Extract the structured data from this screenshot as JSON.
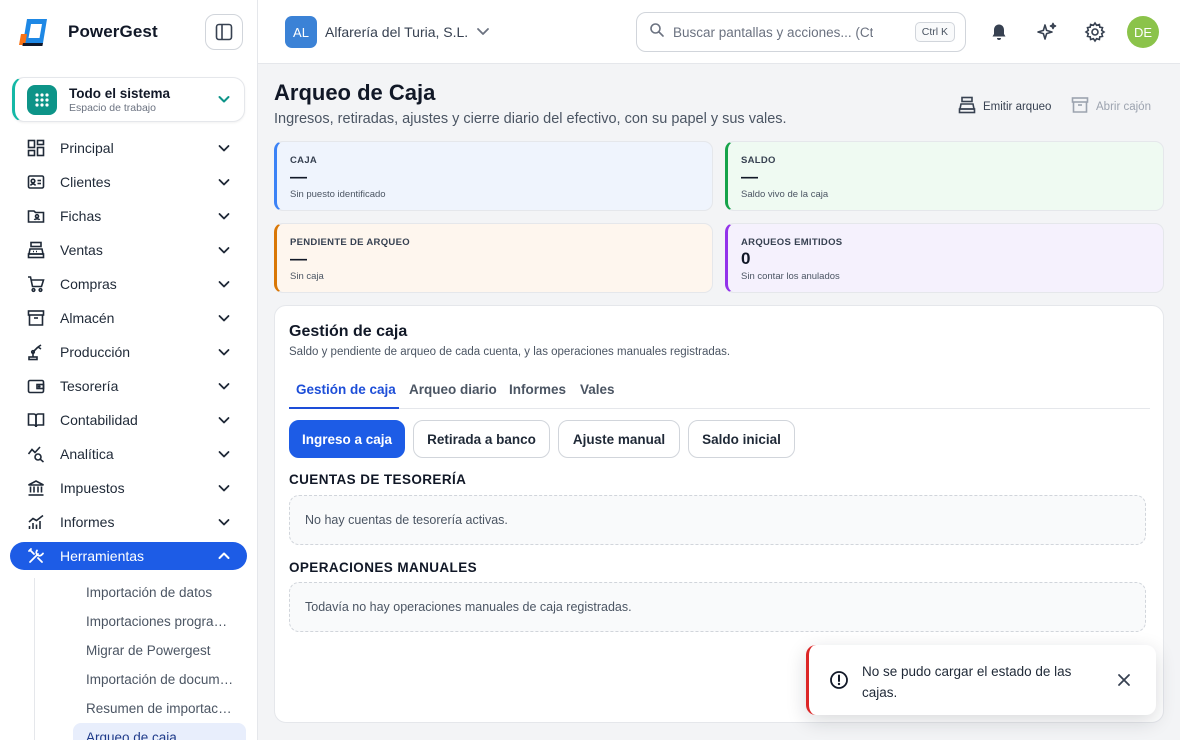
{
  "app": {
    "name": "PowerGest"
  },
  "workspace": {
    "title": "Todo el sistema",
    "subtitle": "Espacio de trabajo"
  },
  "sidebar": {
    "items": [
      {
        "label": "Principal",
        "icon": "dashboard-icon"
      },
      {
        "label": "Clientes",
        "icon": "id-card-icon"
      },
      {
        "label": "Fichas",
        "icon": "folder-user-icon"
      },
      {
        "label": "Ventas",
        "icon": "cash-register-icon"
      },
      {
        "label": "Compras",
        "icon": "cart-icon"
      },
      {
        "label": "Almacén",
        "icon": "archive-box-icon"
      },
      {
        "label": "Producción",
        "icon": "robot-arm-icon"
      },
      {
        "label": "Tesorería",
        "icon": "wallet-icon"
      },
      {
        "label": "Contabilidad",
        "icon": "book-open-icon"
      },
      {
        "label": "Analítica",
        "icon": "chart-search-icon"
      },
      {
        "label": "Impuestos",
        "icon": "bank-icon"
      },
      {
        "label": "Informes",
        "icon": "bar-chart-icon"
      },
      {
        "label": "Herramientas",
        "icon": "tools-icon",
        "active": true
      }
    ],
    "subitems": [
      "Importación de datos",
      "Importaciones programadas",
      "Migrar de Powergest",
      "Importación de documentos",
      "Resumen de importaciones",
      "Arqueo de caja"
    ]
  },
  "topbar": {
    "company_initials": "AL",
    "company_name": "Alfarería del Turia, S.L.",
    "search_placeholder": "Buscar pantallas y acciones... (Ctrl+K)",
    "search_shortcut": "Ctrl K",
    "user_initials": "DE",
    "user_avatar_color": "#8bc34a"
  },
  "page": {
    "title": "Arqueo de Caja",
    "subtitle": "Ingresos, retiradas, ajustes y cierre diario del efectivo, con su papel y sus vales.",
    "actions": {
      "emit": "Emitir arqueo",
      "open_drawer": "Abrir cajón"
    }
  },
  "stats": [
    {
      "label": "CAJA",
      "value": "—",
      "note": "Sin puesto identificado",
      "accent": "#3b82f6",
      "bg": "#eff4fd"
    },
    {
      "label": "SALDO",
      "value": "—",
      "note": "Saldo vivo de la caja",
      "accent": "#16a34a",
      "bg": "#effaf2"
    },
    {
      "label": "PENDIENTE DE ARQUEO",
      "value": "—",
      "note": "Sin caja",
      "accent": "#d97706",
      "bg": "#fef6ee"
    },
    {
      "label": "ARQUEOS EMITIDOS",
      "value": "0",
      "note": "Sin contar los anulados",
      "accent": "#9333ea",
      "bg": "#f5f1fd"
    }
  ],
  "card": {
    "title": "Gestión de caja",
    "subtitle": "Saldo y pendiente de arqueo de cada cuenta, y las operaciones manuales registradas.",
    "tabs": [
      "Gestión de caja",
      "Arqueo diario",
      "Informes",
      "Vales"
    ],
    "buttons": [
      "Ingreso a caja",
      "Retirada a banco",
      "Ajuste manual",
      "Saldo inicial"
    ],
    "section_accounts": "CUENTAS DE TESORERÍA",
    "accounts_empty": "No hay cuentas de tesorería activas.",
    "section_ops": "OPERACIONES MANUALES",
    "ops_empty": "Todavía no hay operaciones manuales de caja registradas."
  },
  "toast": {
    "message": "No se pudo cargar el estado de las cajas.",
    "accent": "#dc2626"
  }
}
